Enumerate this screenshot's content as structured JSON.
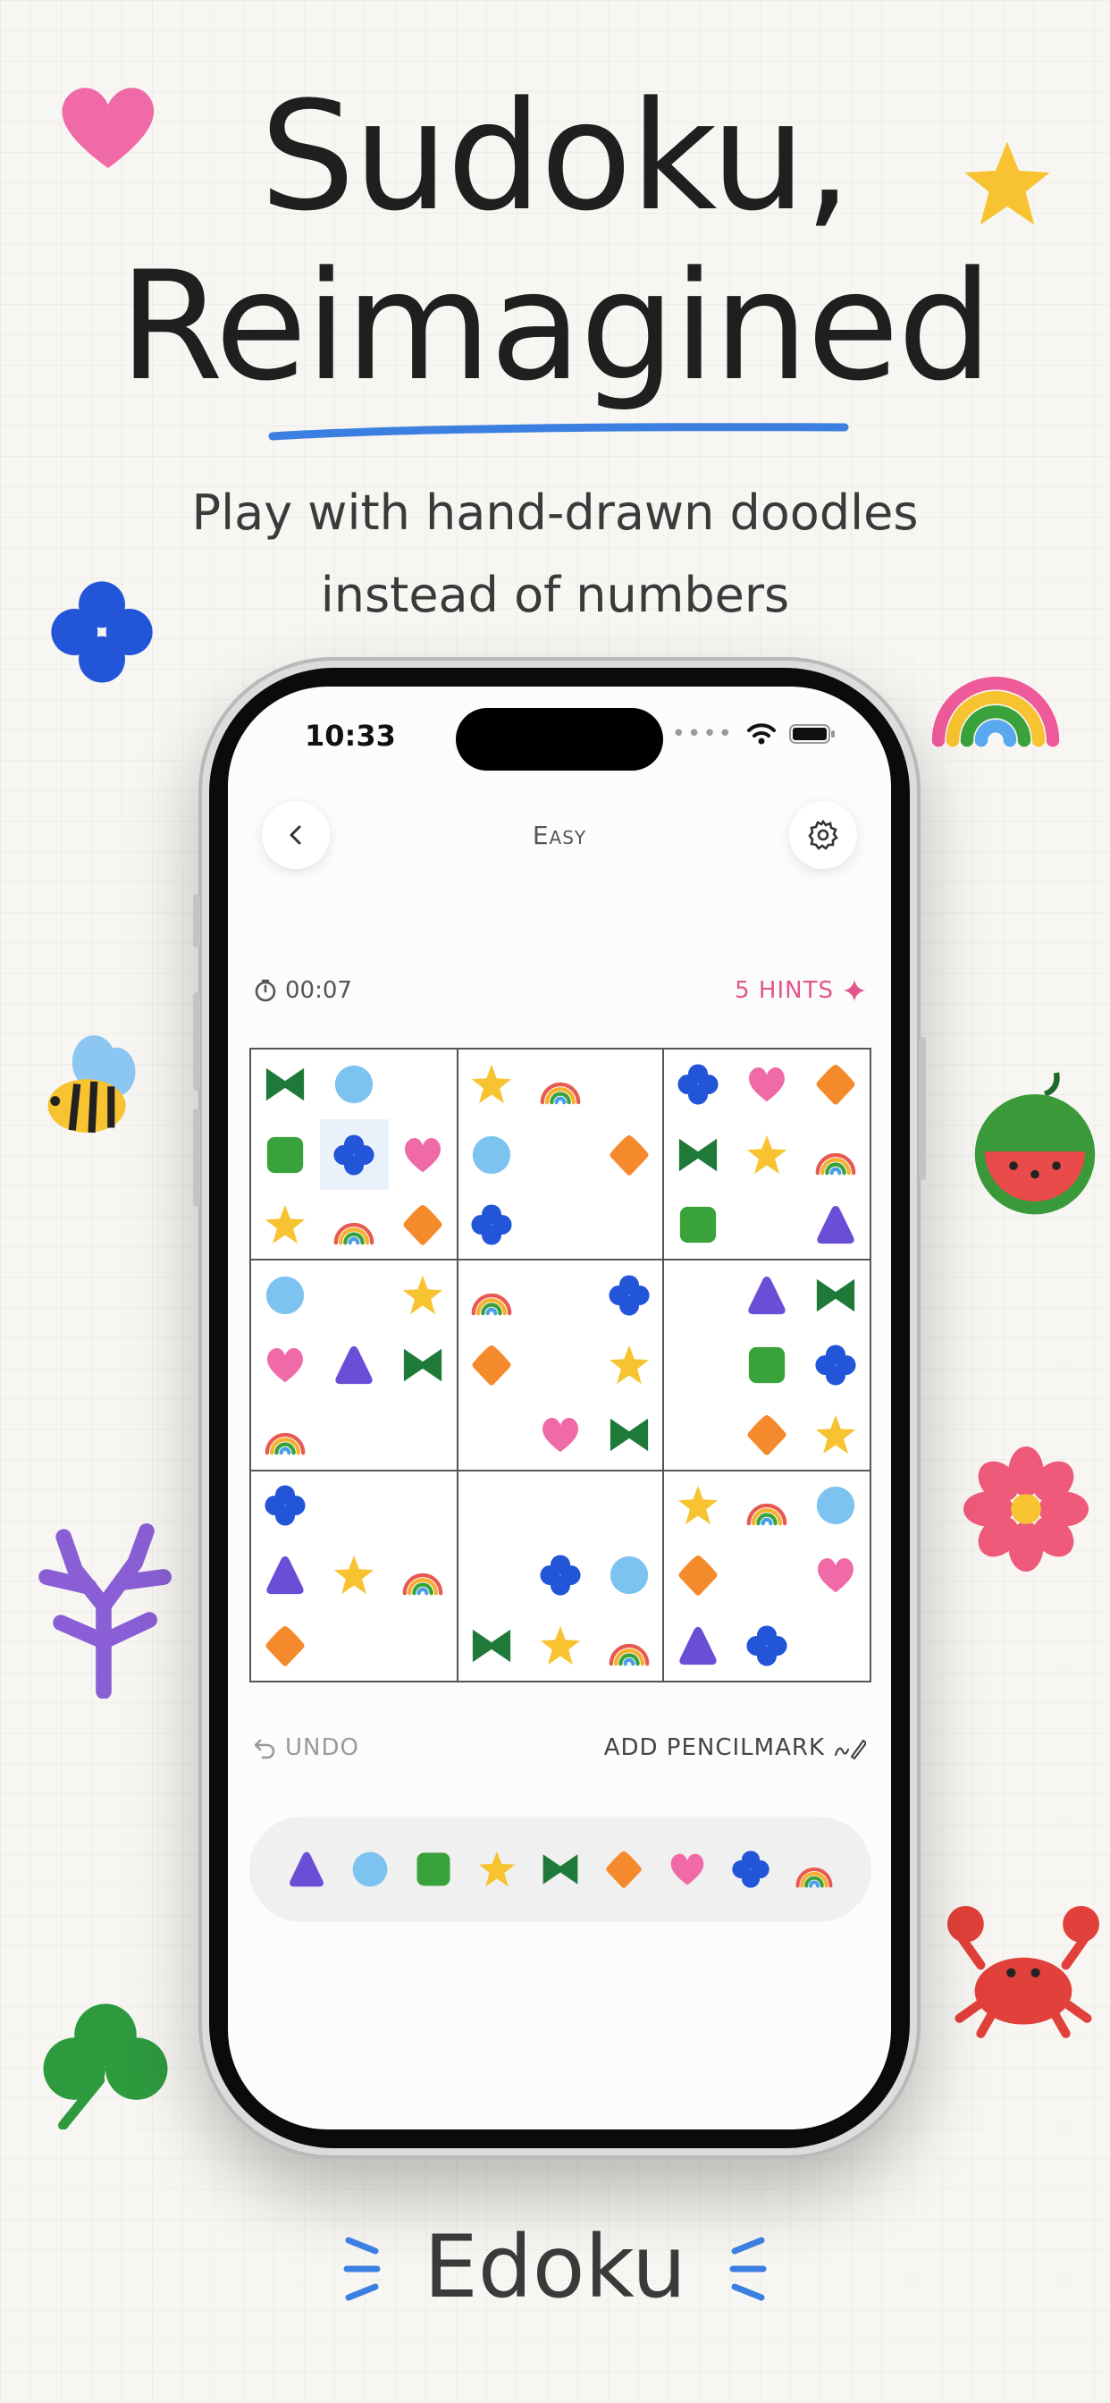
{
  "headline": {
    "line1": "Sudoku,",
    "line2": "Reimagined"
  },
  "subtitle": {
    "line1": "Play with hand-drawn doodles",
    "line2": "instead of numbers"
  },
  "status_bar": {
    "time": "10:33",
    "icons": [
      "signal-dots-icon",
      "wifi-icon",
      "battery-icon"
    ]
  },
  "game_header": {
    "back_icon": "chevron-left-icon",
    "difficulty": "Easy",
    "settings_icon": "gear-icon"
  },
  "timer": {
    "icon": "stopwatch-icon",
    "value": "00:07"
  },
  "hints": {
    "label": "5 HINTS",
    "icon": "sparkle-icon"
  },
  "board": {
    "rows": [
      [
        "bow",
        "circle",
        "",
        "star",
        "rainbow",
        "",
        "clover",
        "heart",
        "diamond"
      ],
      [
        "square",
        "clover",
        "heart",
        "circle",
        "",
        "diamond",
        "bow",
        "star",
        "rainbow"
      ],
      [
        "star",
        "rainbow",
        "diamond",
        "clover",
        "",
        "",
        "square",
        "",
        "triangle"
      ],
      [
        "circle",
        "",
        "star",
        "rainbow",
        "",
        "clover",
        "",
        "triangle",
        "bow"
      ],
      [
        "heart",
        "triangle",
        "bow",
        "diamond",
        "",
        "star",
        "",
        "square",
        "clover"
      ],
      [
        "rainbow",
        "",
        "",
        "",
        "heart",
        "bow",
        "",
        "diamond",
        "star"
      ],
      [
        "clover",
        "",
        "",
        "",
        "",
        "",
        "star",
        "rainbow",
        "circle"
      ],
      [
        "triangle",
        "star",
        "rainbow",
        "",
        "clover",
        "circle",
        "diamond",
        "",
        "heart"
      ],
      [
        "diamond",
        "",
        "",
        "bow",
        "star",
        "rainbow",
        "triangle",
        "clover",
        ""
      ]
    ],
    "selected": {
      "row": 1,
      "col": 1
    }
  },
  "actions": {
    "undo_label": "UNDO",
    "pencilmark_label": "ADD PENCILMARK"
  },
  "palette": [
    "triangle",
    "circle",
    "square",
    "star",
    "bow",
    "diamond",
    "heart",
    "clover",
    "rainbow"
  ],
  "colors": {
    "bow": "#1f7a3a",
    "circle": "#7cc3f0",
    "square": "#3aa23a",
    "star": "#f7c331",
    "rainbow": "#e85a4f",
    "clover": "#2255d8",
    "heart": "#ef6aa6",
    "diamond": "#f58a2c",
    "triangle": "#6a4fd6",
    "accent_blue": "#3b7fe0",
    "hint_pink": "#e2558f"
  },
  "decorations": [
    "heart-doodle",
    "star-doodle",
    "clover-doodle",
    "rainbow-doodle",
    "bee-doodle",
    "watermelon-doodle",
    "flower-doodle",
    "coral-doodle",
    "crab-doodle",
    "shamrock-doodle"
  ],
  "brand": {
    "name": "Edoku"
  }
}
